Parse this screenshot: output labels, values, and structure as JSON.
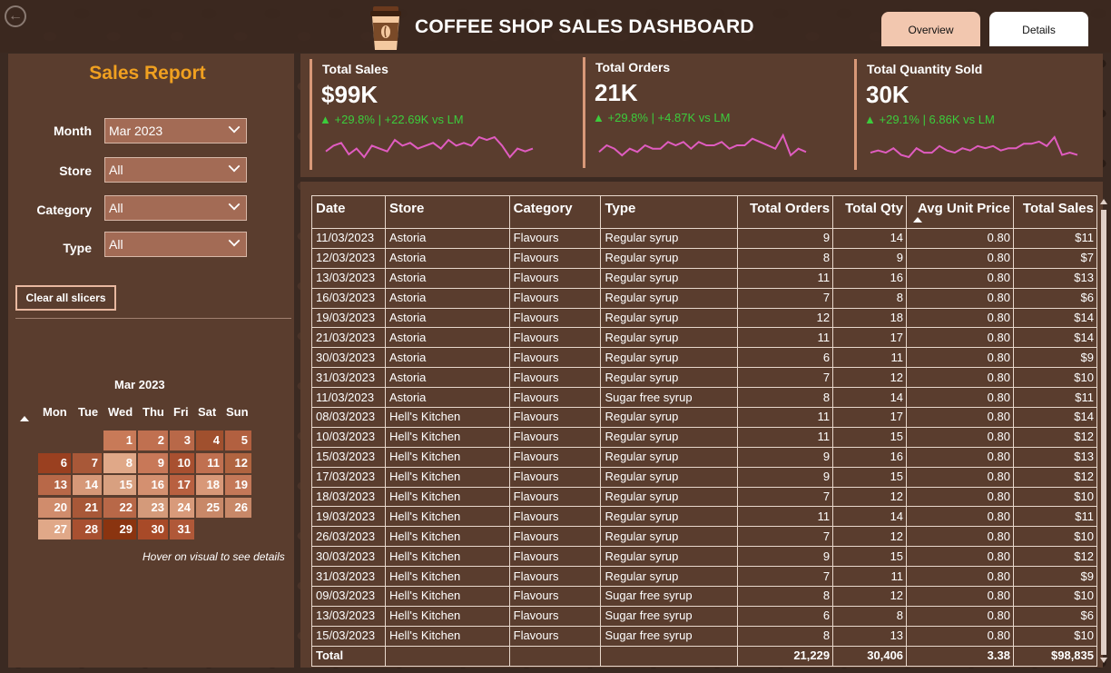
{
  "header": {
    "title": "COFFEE SHOP SALES DASHBOARD",
    "tabs": [
      {
        "label": "Overview",
        "active": true,
        "color": "#f2c7af"
      },
      {
        "label": "Details",
        "active": false,
        "color": "#ffffff"
      }
    ]
  },
  "sidebar": {
    "title": "Sales Report",
    "slicers": [
      {
        "label": "Month",
        "value": "Mar 2023"
      },
      {
        "label": "Store",
        "value": "All"
      },
      {
        "label": "Category",
        "value": "All"
      },
      {
        "label": "Type",
        "value": "All"
      }
    ],
    "clear_label": "Clear all slicers",
    "calendar": {
      "title": "Mar 2023",
      "day_names": [
        "Mon",
        "Tue",
        "Wed",
        "Thu",
        "Fri",
        "Sat",
        "Sun"
      ],
      "weeks": [
        [
          null,
          null,
          1,
          2,
          3,
          4,
          5
        ],
        [
          6,
          7,
          8,
          9,
          10,
          11,
          12
        ],
        [
          13,
          14,
          15,
          16,
          17,
          18,
          19
        ],
        [
          20,
          21,
          22,
          23,
          24,
          25,
          26
        ],
        [
          27,
          28,
          29,
          30,
          31,
          null,
          null
        ]
      ],
      "heat": {
        "1": "#c87a58",
        "2": "#c07050",
        "3": "#b86848",
        "4": "#a0502e",
        "5": "#b26040",
        "6": "#9a4020",
        "7": "#a85838",
        "8": "#e0a888",
        "9": "#c87858",
        "10": "#a85030",
        "11": "#c07050",
        "12": "#b06440",
        "13": "#b86848",
        "14": "#d69878",
        "15": "#d8a080",
        "16": "#d49070",
        "17": "#b86040",
        "18": "#d89878",
        "19": "#c47858",
        "20": "#d08c6c",
        "21": "#a85838",
        "22": "#b86848",
        "23": "#d49a7a",
        "24": "#d89a7a",
        "25": "#c88868",
        "26": "#c88868",
        "27": "#e0a888",
        "28": "#a85030",
        "29": "#8a3410",
        "30": "#a84a28",
        "31": "#b05838"
      }
    },
    "hover_note": "Hover on visual to see details"
  },
  "kpis": [
    {
      "title": "Total Sales",
      "value": "$99K",
      "delta": "+29.8% | +22.69K vs LM",
      "spark": [
        4,
        6,
        7,
        3,
        5,
        2,
        6,
        5,
        4,
        8,
        6,
        7,
        5,
        6,
        7,
        5,
        8,
        6,
        7,
        6,
        9,
        8,
        9,
        6,
        2,
        5,
        4,
        5
      ]
    },
    {
      "title": "Total Orders",
      "value": "21K",
      "delta": "+29.8% | +4.87K vs LM",
      "spark": [
        4,
        6,
        5,
        3,
        5,
        4,
        6,
        5,
        5,
        7,
        6,
        7,
        5,
        7,
        6,
        6,
        7,
        5,
        6,
        6,
        8,
        7,
        6,
        5,
        9,
        3,
        5,
        4
      ]
    },
    {
      "title": "Total Quantity Sold",
      "value": "30K",
      "delta": "+29.1% | 6.86K vs LM",
      "spark": [
        4,
        5,
        4,
        6,
        3,
        2,
        6,
        4,
        4,
        7,
        5,
        4,
        6,
        5,
        7,
        6,
        7,
        5,
        6,
        6,
        8,
        8,
        9,
        7,
        11,
        3,
        4,
        3
      ]
    }
  ],
  "accent_color": "#3ccc3c",
  "table": {
    "columns": [
      "Date",
      "Store",
      "Category",
      "Type",
      "Total Orders",
      "Total Qty",
      "Avg Unit Price",
      "Total Sales"
    ],
    "rows": [
      [
        "11/03/2023",
        "Astoria",
        "Flavours",
        "Regular syrup",
        "9",
        "14",
        "0.80",
        "$11"
      ],
      [
        "12/03/2023",
        "Astoria",
        "Flavours",
        "Regular syrup",
        "8",
        "9",
        "0.80",
        "$7"
      ],
      [
        "13/03/2023",
        "Astoria",
        "Flavours",
        "Regular syrup",
        "11",
        "16",
        "0.80",
        "$13"
      ],
      [
        "16/03/2023",
        "Astoria",
        "Flavours",
        "Regular syrup",
        "7",
        "8",
        "0.80",
        "$6"
      ],
      [
        "19/03/2023",
        "Astoria",
        "Flavours",
        "Regular syrup",
        "12",
        "18",
        "0.80",
        "$14"
      ],
      [
        "21/03/2023",
        "Astoria",
        "Flavours",
        "Regular syrup",
        "11",
        "17",
        "0.80",
        "$14"
      ],
      [
        "30/03/2023",
        "Astoria",
        "Flavours",
        "Regular syrup",
        "6",
        "11",
        "0.80",
        "$9"
      ],
      [
        "31/03/2023",
        "Astoria",
        "Flavours",
        "Regular syrup",
        "7",
        "12",
        "0.80",
        "$10"
      ],
      [
        "11/03/2023",
        "Astoria",
        "Flavours",
        "Sugar free syrup",
        "8",
        "14",
        "0.80",
        "$11"
      ],
      [
        "08/03/2023",
        "Hell's Kitchen",
        "Flavours",
        "Regular syrup",
        "11",
        "17",
        "0.80",
        "$14"
      ],
      [
        "10/03/2023",
        "Hell's Kitchen",
        "Flavours",
        "Regular syrup",
        "11",
        "15",
        "0.80",
        "$12"
      ],
      [
        "15/03/2023",
        "Hell's Kitchen",
        "Flavours",
        "Regular syrup",
        "9",
        "16",
        "0.80",
        "$13"
      ],
      [
        "17/03/2023",
        "Hell's Kitchen",
        "Flavours",
        "Regular syrup",
        "9",
        "15",
        "0.80",
        "$12"
      ],
      [
        "18/03/2023",
        "Hell's Kitchen",
        "Flavours",
        "Regular syrup",
        "7",
        "12",
        "0.80",
        "$10"
      ],
      [
        "19/03/2023",
        "Hell's Kitchen",
        "Flavours",
        "Regular syrup",
        "11",
        "14",
        "0.80",
        "$11"
      ],
      [
        "26/03/2023",
        "Hell's Kitchen",
        "Flavours",
        "Regular syrup",
        "7",
        "12",
        "0.80",
        "$10"
      ],
      [
        "30/03/2023",
        "Hell's Kitchen",
        "Flavours",
        "Regular syrup",
        "9",
        "15",
        "0.80",
        "$12"
      ],
      [
        "31/03/2023",
        "Hell's Kitchen",
        "Flavours",
        "Regular syrup",
        "7",
        "11",
        "0.80",
        "$9"
      ],
      [
        "09/03/2023",
        "Hell's Kitchen",
        "Flavours",
        "Sugar free syrup",
        "8",
        "12",
        "0.80",
        "$10"
      ],
      [
        "13/03/2023",
        "Hell's Kitchen",
        "Flavours",
        "Sugar free syrup",
        "6",
        "8",
        "0.80",
        "$6"
      ],
      [
        "15/03/2023",
        "Hell's Kitchen",
        "Flavours",
        "Sugar free syrup",
        "8",
        "13",
        "0.80",
        "$10"
      ]
    ],
    "total": {
      "label": "Total",
      "orders": "21,229",
      "qty": "30,406",
      "avg_price": "3.38",
      "sales": "$98,835"
    }
  }
}
